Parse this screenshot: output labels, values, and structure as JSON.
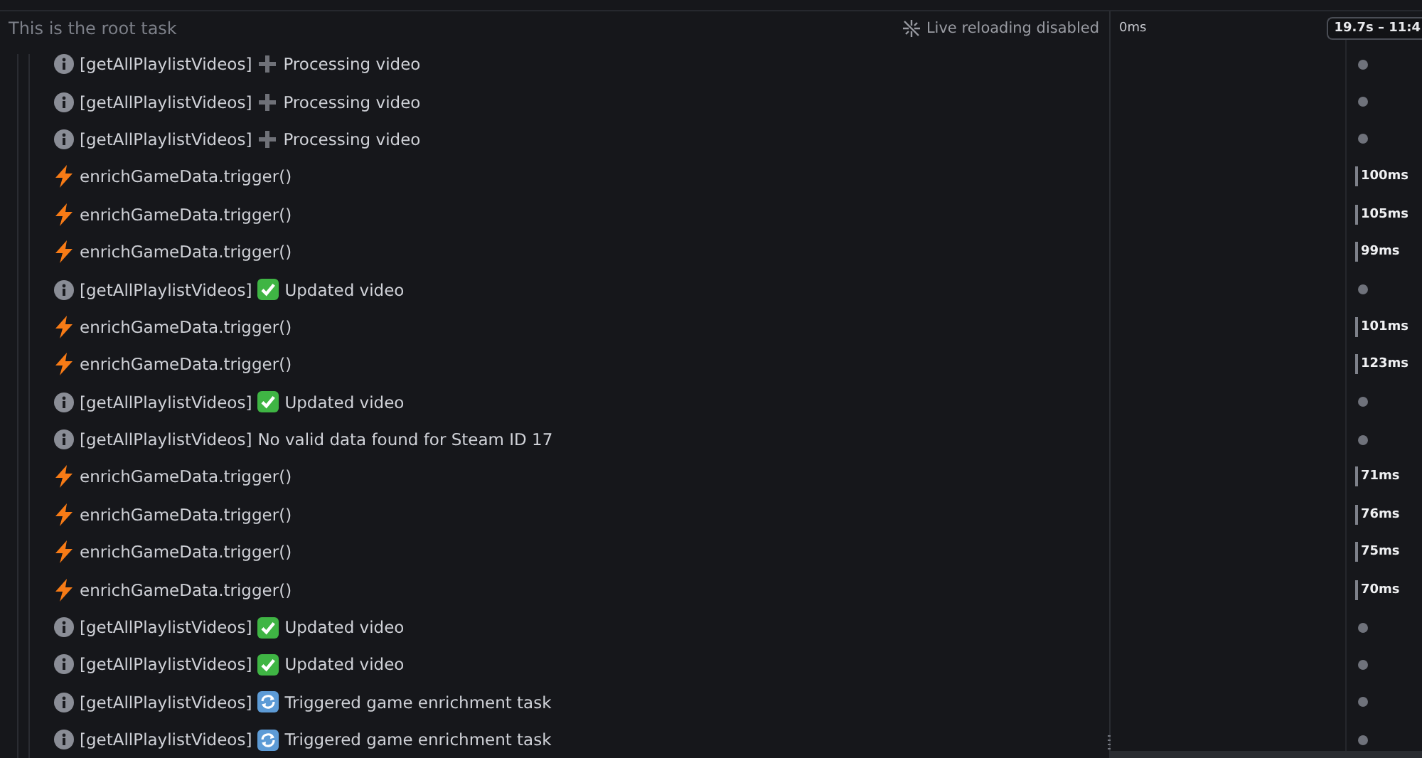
{
  "header": {
    "title": "This is the root task",
    "live_reloading": "Live reloading disabled",
    "timeline_start": "0ms",
    "time_badge": "19.7s – 11:4"
  },
  "rows": [
    {
      "kind": "log",
      "prefix": "[getAllPlaylistVideos]",
      "emoji": {
        "kind": "plus"
      },
      "message": "Processing video"
    },
    {
      "kind": "log",
      "prefix": "[getAllPlaylistVideos]",
      "emoji": {
        "kind": "plus"
      },
      "message": "Processing video"
    },
    {
      "kind": "log",
      "prefix": "[getAllPlaylistVideos]",
      "emoji": {
        "kind": "plus"
      },
      "message": "Processing video"
    },
    {
      "kind": "trigger",
      "message": "enrichGameData.trigger()",
      "duration": "100ms"
    },
    {
      "kind": "trigger",
      "message": "enrichGameData.trigger()",
      "duration": "105ms"
    },
    {
      "kind": "trigger",
      "message": "enrichGameData.trigger()",
      "duration": "99ms"
    },
    {
      "kind": "log",
      "prefix": "[getAllPlaylistVideos]",
      "emoji": {
        "kind": "check"
      },
      "message": "Updated video"
    },
    {
      "kind": "trigger",
      "message": "enrichGameData.trigger()",
      "duration": "101ms"
    },
    {
      "kind": "trigger",
      "message": "enrichGameData.trigger()",
      "duration": "123ms"
    },
    {
      "kind": "log",
      "prefix": "[getAllPlaylistVideos]",
      "emoji": {
        "kind": "check"
      },
      "message": "Updated video"
    },
    {
      "kind": "log",
      "prefix": "[getAllPlaylistVideos]",
      "message": "No valid data found for Steam ID 17"
    },
    {
      "kind": "trigger",
      "message": "enrichGameData.trigger()",
      "duration": "71ms"
    },
    {
      "kind": "trigger",
      "message": "enrichGameData.trigger()",
      "duration": "76ms"
    },
    {
      "kind": "trigger",
      "message": "enrichGameData.trigger()",
      "duration": "75ms"
    },
    {
      "kind": "trigger",
      "message": "enrichGameData.trigger()",
      "duration": "70ms"
    },
    {
      "kind": "log",
      "prefix": "[getAllPlaylistVideos]",
      "emoji": {
        "kind": "check"
      },
      "message": "Updated video"
    },
    {
      "kind": "log",
      "prefix": "[getAllPlaylistVideos]",
      "emoji": {
        "kind": "check"
      },
      "message": "Updated video"
    },
    {
      "kind": "log",
      "prefix": "[getAllPlaylistVideos]",
      "emoji": {
        "kind": "refresh"
      },
      "message": "Triggered game enrichment task"
    },
    {
      "kind": "log",
      "prefix": "[getAllPlaylistVideos]",
      "emoji": {
        "kind": "refresh"
      },
      "message": "Triggered game enrichment task"
    }
  ]
}
